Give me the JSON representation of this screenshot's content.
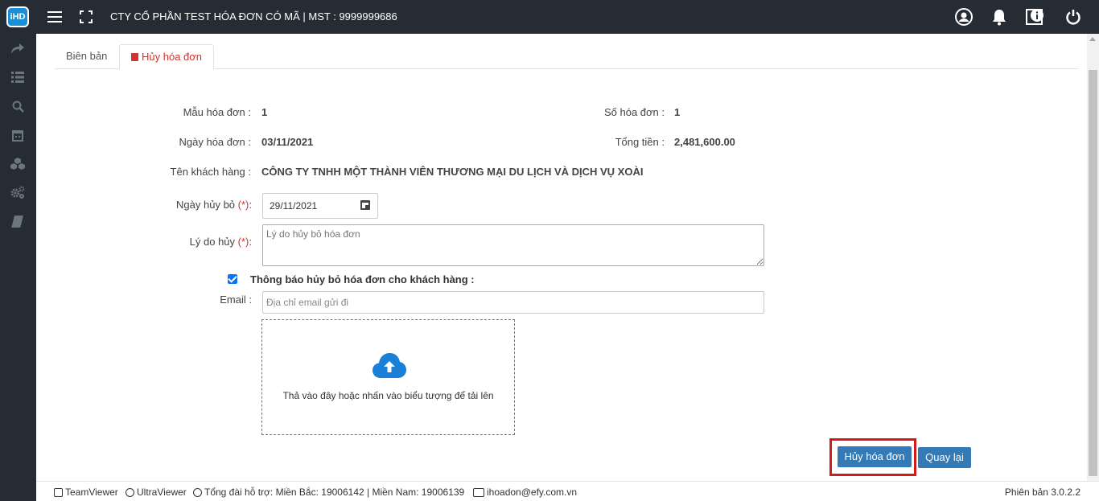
{
  "header": {
    "logo_text": "iHD",
    "company": "CTY CỔ PHẦN TEST HÓA ĐƠN CÓ MÃ | MST : 9999999686",
    "icons": [
      "menu-icon",
      "fullscreen-icon",
      "user-icon",
      "bell-icon",
      "info-icon",
      "power-icon"
    ]
  },
  "sidebar": {
    "icons": [
      "share-icon",
      "list-icon",
      "search-icon",
      "calendar-icon",
      "cubes-icon",
      "cogs-icon",
      "book-icon"
    ]
  },
  "tabs": [
    {
      "label": "Biên bản"
    },
    {
      "label": "Hủy hóa đơn"
    }
  ],
  "form": {
    "mau_label": "Mẫu hóa đơn :",
    "mau_value": "1",
    "so_label": "Số hóa đơn :",
    "so_value": "1",
    "ngay_label": "Ngày hóa đơn :",
    "ngay_value": "03/11/2021",
    "tong_label": "Tổng tiền :",
    "tong_value": "2,481,600.00",
    "kh_label": "Tên khách hàng :",
    "kh_value": "CÔNG TY TNHH MỘT THÀNH VIÊN THƯƠNG MẠI DU LỊCH VÀ DỊCH VỤ XOÀI",
    "ngay_huy_label": "Ngày hủy bỏ",
    "required_mark": "(*)",
    "ngay_huy_value": "29/11/2021",
    "ly_do_label": "Lý do hủy",
    "ly_do_placeholder": "Lý do hủy bỏ hóa đơn",
    "notify_checked": true,
    "notify_label": "Thông báo hủy bỏ hóa đơn cho khách hàng :",
    "email_label": "Email :",
    "email_placeholder": "Địa chỉ email gửi đi",
    "drop_text": "Thả vào đây hoặc nhấn vào biểu tượng để tải lên"
  },
  "buttons": {
    "cancel": "Hủy hóa đơn",
    "back": "Quay lại"
  },
  "footer": {
    "teamviewer": "TeamViewer",
    "ultraviewer": "UltraViewer",
    "hotline": "Tổng đài hỗ trợ: Miền Bắc: 19006142 | Miền Nam: 19006139",
    "email": "ihoadon@efy.com.vn",
    "version": "Phiên bản 3.0.2.2"
  },
  "colors": {
    "topbar": "#262c33",
    "accent": "#337ab7",
    "danger": "#d0342c",
    "highlight": "#d21b1b"
  }
}
